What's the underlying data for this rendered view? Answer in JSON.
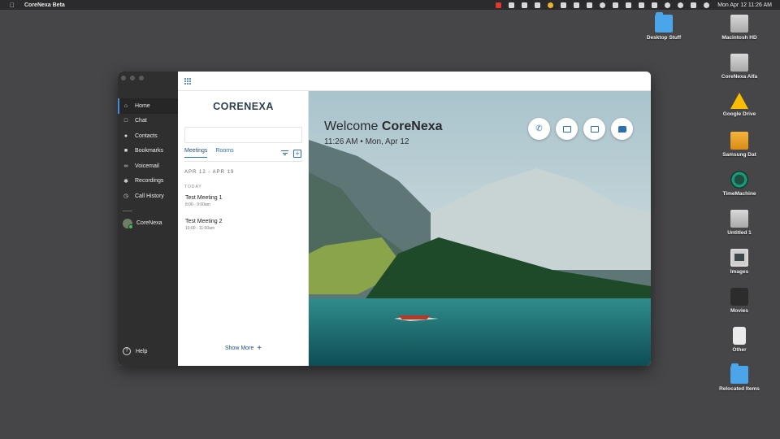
{
  "menubar": {
    "app_name": "CoreNexa Beta",
    "clock": "Mon Apr 12  11:26 AM",
    "status_icons": [
      "record-icon",
      "shield-icon",
      "malwarebytes-icon",
      "notes-icon",
      "pinwheel-icon",
      "headphones-icon",
      "cast-icon",
      "screen-icon",
      "time-machine-icon",
      "flag-icon",
      "bluetooth-icon",
      "battery-icon",
      "wifi-icon",
      "user-icon",
      "search-icon",
      "control-center-icon",
      "siri-icon"
    ]
  },
  "desktop": {
    "icons": [
      {
        "label": "Desktop Stuff",
        "kind": "folder"
      },
      {
        "label": "Macintosh HD",
        "kind": "drive"
      },
      {
        "label": "CoreNexa Alfa",
        "kind": "drive"
      },
      {
        "label": "Google Drive",
        "kind": "gdrive"
      },
      {
        "label": "Samsung Dat",
        "kind": "drive-orange"
      },
      {
        "label": "TimeMachine",
        "kind": "tm"
      },
      {
        "label": "Untitled 1",
        "kind": "drive"
      },
      {
        "label": "Images",
        "kind": "img"
      },
      {
        "label": "Movies",
        "kind": "movie"
      },
      {
        "label": "Other",
        "kind": "other"
      },
      {
        "label": "Relocated Items",
        "kind": "folder"
      }
    ]
  },
  "sidebar": {
    "items": [
      {
        "label": "Home",
        "icon": "home-icon",
        "active": true
      },
      {
        "label": "Chat",
        "icon": "chat-icon"
      },
      {
        "label": "Contacts",
        "icon": "contacts-icon"
      },
      {
        "label": "Bookmarks",
        "icon": "bookmarks-icon"
      },
      {
        "label": "Voicemail",
        "icon": "voicemail-icon"
      },
      {
        "label": "Recordings",
        "icon": "recordings-icon"
      },
      {
        "label": "Call History",
        "icon": "call-history-icon"
      }
    ],
    "user": "CoreNexa",
    "help": "Help"
  },
  "panel": {
    "logo": "CORENEXA",
    "search_value": "",
    "tabs": [
      "Meetings",
      "Rooms"
    ],
    "range": "APR 12 - APR 19",
    "today": "TODAY",
    "meetings": [
      {
        "title": "Test Meeting 1",
        "time": "8:00 - 9:00am"
      },
      {
        "title": "Test Meeting 2",
        "time": "10:00 - 11:00am"
      }
    ],
    "show_more": "Show More"
  },
  "hero": {
    "welcome_prefix": "Welcome",
    "welcome_name": "CoreNexa",
    "time": "11:26 AM • Mon, Apr 12",
    "actions": [
      "phone-icon",
      "join-meeting-icon",
      "share-screen-icon",
      "message-icon"
    ]
  },
  "colors": {
    "accent": "#2a6fb8",
    "sidebar_bg": "#2f2f30",
    "desktop_bg": "#464648"
  }
}
